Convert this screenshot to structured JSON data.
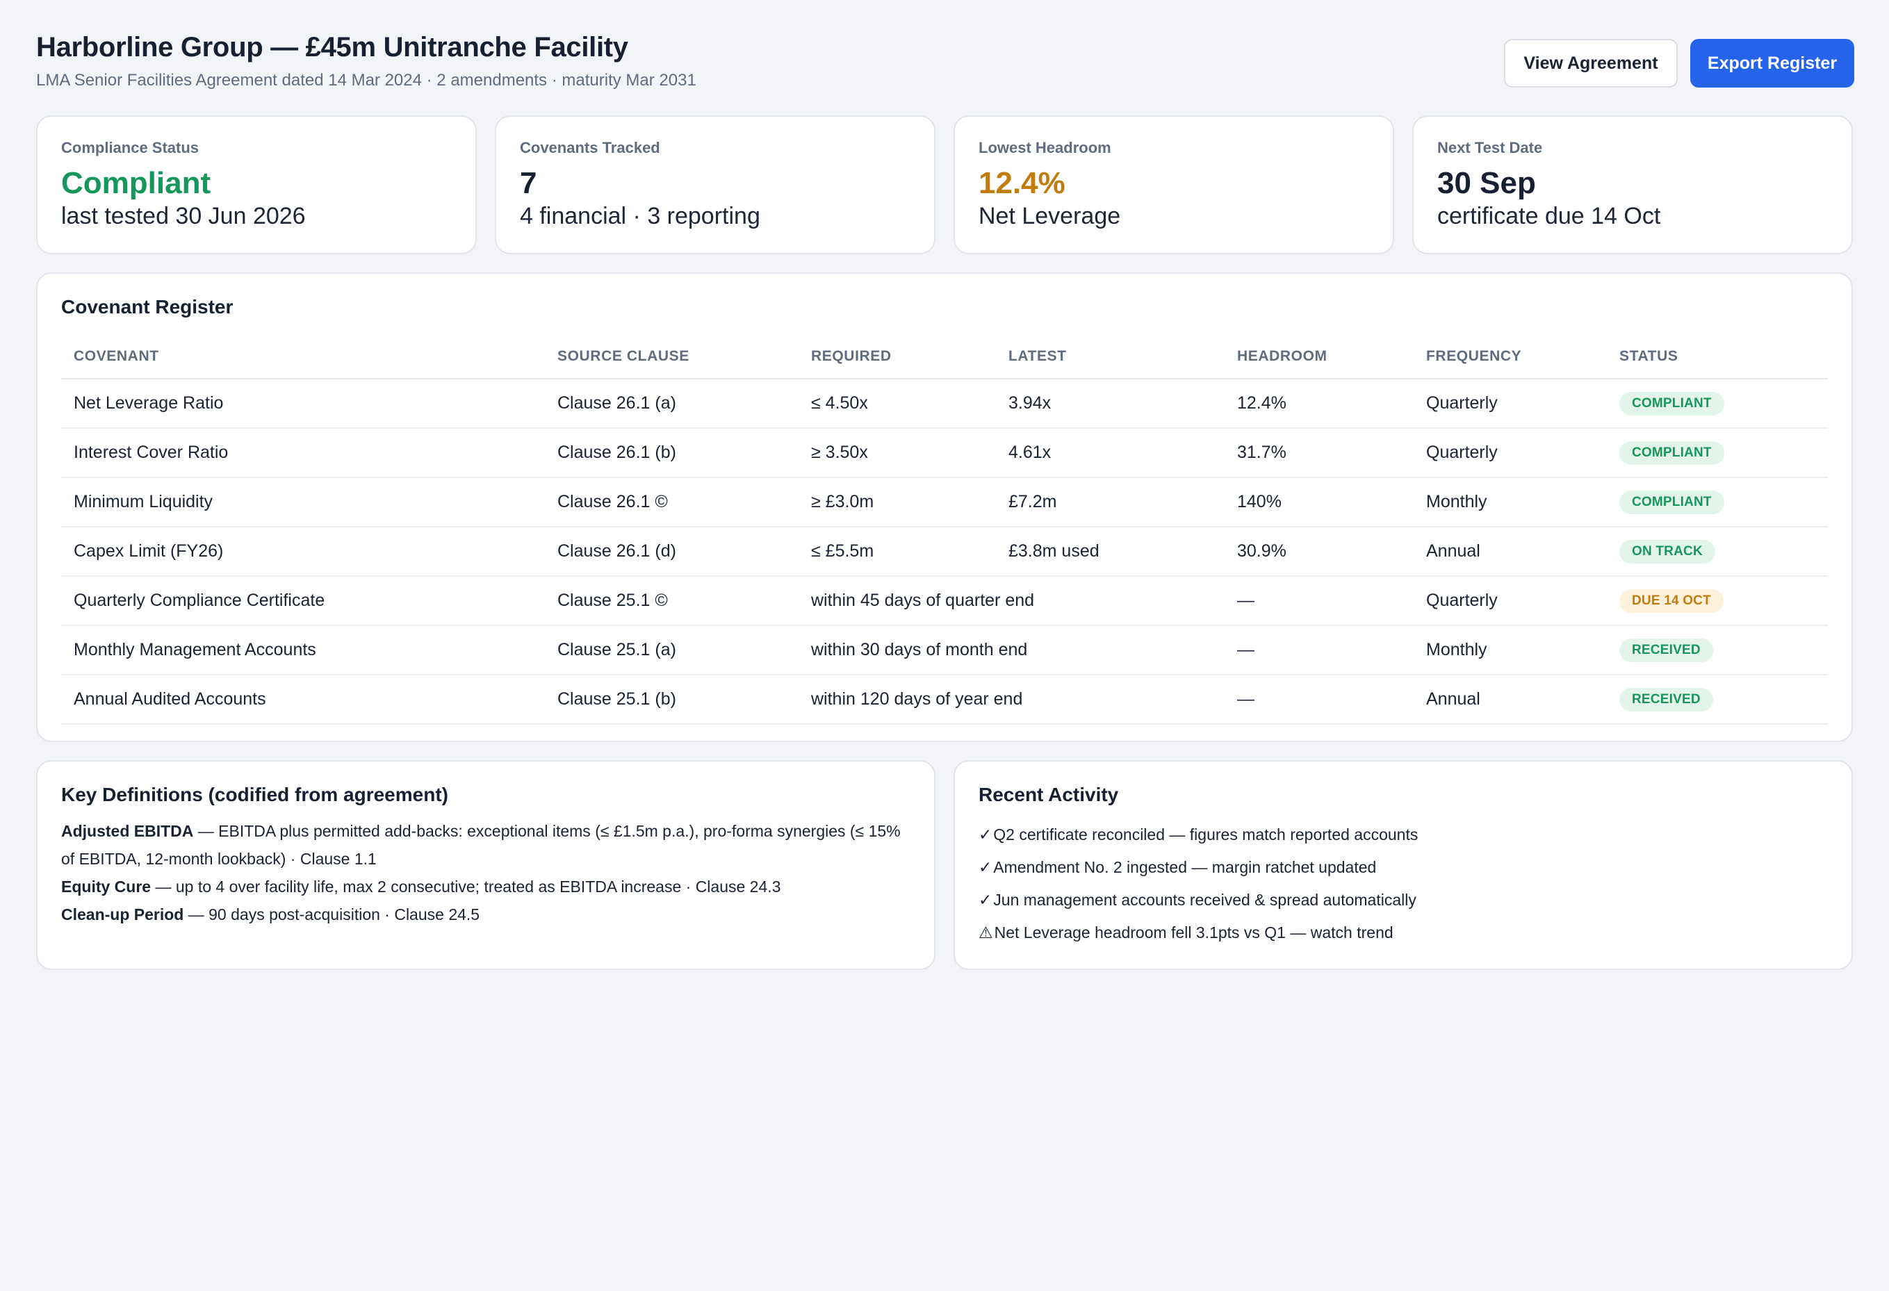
{
  "header": {
    "title": "Harborline Group — £45m Unitranche Facility",
    "subtitle": "LMA Senior Facilities Agreement dated 14 Mar 2024 · 2 amendments · maturity Mar 2031",
    "view_button": "View Agreement",
    "export_button": "Export Register"
  },
  "kpis": [
    {
      "label": "Compliance Status",
      "value": "Compliant",
      "sub": "last tested 30 Jun 2026",
      "color": "#15965a"
    },
    {
      "label": "Covenants Tracked",
      "value": "7",
      "sub": "4 financial · 3 reporting",
      "color": "#172033"
    },
    {
      "label": "Lowest Headroom",
      "value": "12.4%",
      "sub": "Net Leverage",
      "color": "#c27c0e"
    },
    {
      "label": "Next Test Date",
      "value": "30 Sep",
      "sub": "certificate due 14 Oct",
      "color": "#172033"
    }
  ],
  "register": {
    "title": "Covenant Register",
    "columns": [
      "COVENANT",
      "SOURCE CLAUSE",
      "REQUIRED",
      "LATEST",
      "HEADROOM",
      "FREQUENCY",
      "STATUS"
    ],
    "rows": [
      {
        "covenant": "Net Leverage Ratio",
        "clause": "Clause 26.1 (a)",
        "required": "≤ 4.50x",
        "latest": "3.94x",
        "headroom": "12.4%",
        "frequency": "Quarterly",
        "status": "COMPLIANT",
        "status_tone": "green"
      },
      {
        "covenant": "Interest Cover Ratio",
        "clause": "Clause 26.1 (b)",
        "required": "≥ 3.50x",
        "latest": "4.61x",
        "headroom": "31.7%",
        "frequency": "Quarterly",
        "status": "COMPLIANT",
        "status_tone": "green"
      },
      {
        "covenant": "Minimum Liquidity",
        "clause": "Clause 26.1 ©",
        "required": "≥ £3.0m",
        "latest": "£7.2m",
        "headroom": "140%",
        "frequency": "Monthly",
        "status": "COMPLIANT",
        "status_tone": "green"
      },
      {
        "covenant": "Capex Limit (FY26)",
        "clause": "Clause 26.1 (d)",
        "required": "≤ £5.5m",
        "latest": "£3.8m used",
        "headroom": "30.9%",
        "frequency": "Annual",
        "status": "ON TRACK",
        "status_tone": "green"
      },
      {
        "covenant": "Quarterly Compliance Certificate",
        "clause": "Clause 25.1 ©",
        "required": "within 45 days of quarter end",
        "latest": "",
        "headroom": "—",
        "frequency": "Quarterly",
        "status": "DUE 14 OCT",
        "status_tone": "amber"
      },
      {
        "covenant": "Monthly Management Accounts",
        "clause": "Clause 25.1 (a)",
        "required": "within 30 days of month end",
        "latest": "",
        "headroom": "—",
        "frequency": "Monthly",
        "status": "RECEIVED",
        "status_tone": "green"
      },
      {
        "covenant": "Annual Audited Accounts",
        "clause": "Clause 25.1 (b)",
        "required": "within 120 days of year end",
        "latest": "",
        "headroom": "—",
        "frequency": "Annual",
        "status": "RECEIVED",
        "status_tone": "green"
      }
    ]
  },
  "definitions": {
    "title": "Key Definitions (codified from agreement)",
    "items": [
      {
        "term": "Adjusted EBITDA",
        "text": " — EBITDA plus permitted add-backs: exceptional items (≤ £1.5m p.a.), pro-forma synergies (≤ 15% of EBITDA, 12-month lookback) · Clause 1.1"
      },
      {
        "term": "Equity Cure",
        "text": " — up to 4 over facility life, max 2 consecutive; treated as EBITDA increase · Clause 24.3"
      },
      {
        "term": "Clean-up Period",
        "text": " — 90 days post-acquisition · Clause 24.5"
      }
    ]
  },
  "activity": {
    "title": "Recent Activity",
    "items": [
      {
        "icon": "✓",
        "icon_name": "check-icon",
        "text": "Q2 certificate reconciled — figures match reported accounts"
      },
      {
        "icon": "✓",
        "icon_name": "check-icon",
        "text": "Amendment No. 2 ingested — margin ratchet updated"
      },
      {
        "icon": "✓",
        "icon_name": "check-icon",
        "text": "Jun management accounts received & spread automatically"
      },
      {
        "icon": "⚠",
        "icon_name": "warning-icon",
        "text": "Net Leverage headroom fell 3.1pts vs Q1 — watch trend"
      }
    ]
  }
}
